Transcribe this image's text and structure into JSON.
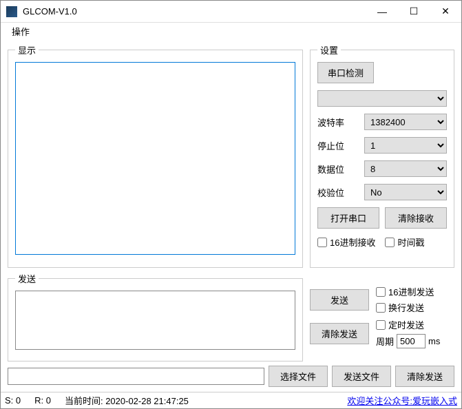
{
  "window": {
    "title": "GLCOM-V1.0"
  },
  "menu": {
    "op": "操作"
  },
  "display": {
    "legend": "显示"
  },
  "settings": {
    "legend": "设置",
    "detect": "串口检测",
    "port_sel": "",
    "baud_label": "波特率",
    "baud_value": "1382400",
    "stop_label": "停止位",
    "stop_value": "1",
    "data_label": "数据位",
    "data_value": "8",
    "parity_label": "校验位",
    "parity_value": "No",
    "open": "打开串口",
    "clear_rx": "清除接收",
    "hex_rx": "16进制接收",
    "timestamp": "时间戳"
  },
  "send": {
    "legend": "发送",
    "send": "发送",
    "clear_tx": "清除发送",
    "hex_tx": "16进制发送",
    "newline": "换行发送",
    "timed": "定时发送",
    "period_label": "周期",
    "period_value": "500",
    "period_unit": "ms"
  },
  "filebar": {
    "choose": "选择文件",
    "send": "发送文件",
    "clear": "清除发送"
  },
  "status": {
    "s": "S: 0",
    "r": "R: 0",
    "time": "当前时间: 2020-02-28 21:47:25",
    "link": "欢迎关注公众号:爱玩嵌入式"
  }
}
